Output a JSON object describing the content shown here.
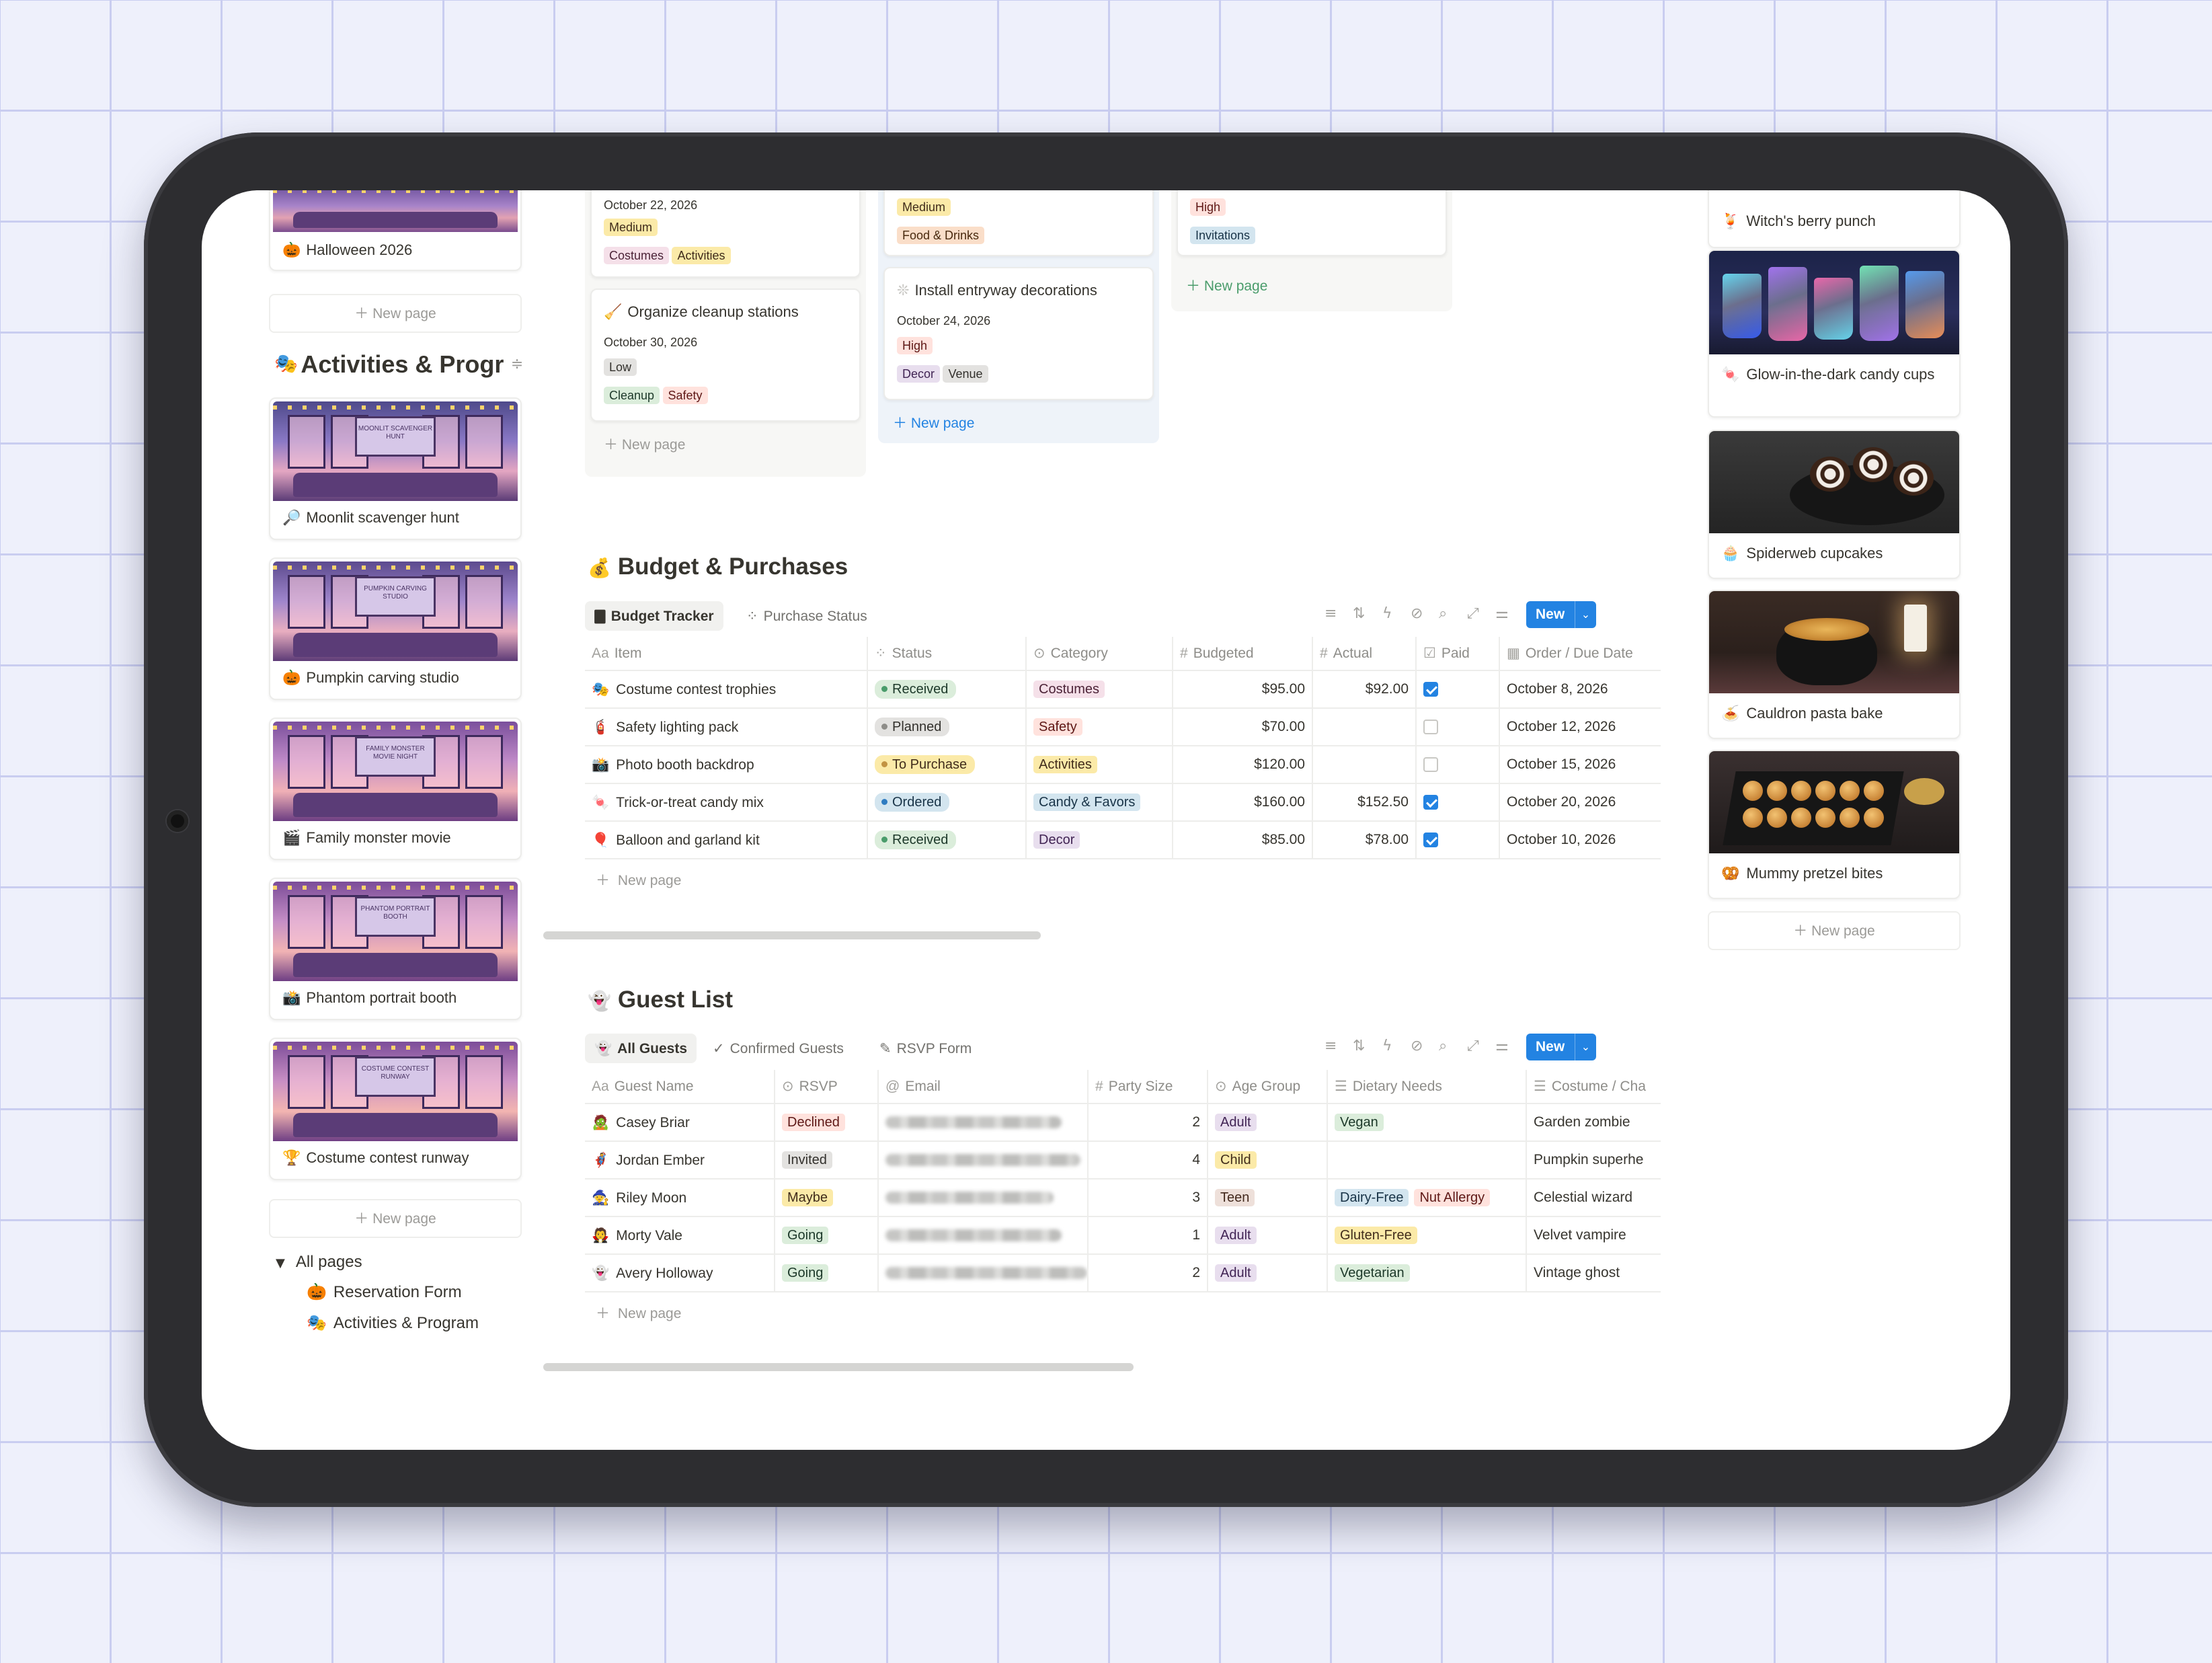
{
  "left_sidebar": {
    "halloween_card_label": "Halloween 2026",
    "new_page": "New page",
    "section_title": "Activities & Progr",
    "gallery": [
      {
        "label": "Moonlit scavenger hunt",
        "icon": "magnifier-icon",
        "sign": "MOONLIT SCAVENGER HUNT"
      },
      {
        "label": "Pumpkin carving studio",
        "icon": "pumpkin-icon",
        "sign": "PUMPKIN CARVING STUDIO"
      },
      {
        "label": "Family monster movie",
        "icon": "clapper-icon",
        "sign": "FAMILY MONSTER MOVIE NIGHT"
      },
      {
        "label": "Phantom portrait booth",
        "icon": "camera-icon",
        "sign": "PHANTOM PORTRAIT BOOTH"
      },
      {
        "label": "Costume contest runway",
        "icon": "trophy-icon",
        "sign": "COSTUME CONTEST RUNWAY"
      }
    ],
    "all_pages_label": "All pages",
    "tree_items": [
      "Reservation Form",
      "Activities & Program"
    ]
  },
  "board": {
    "col1": {
      "card_top": {
        "date": "October 22, 2026",
        "priority": "Medium",
        "tags": [
          "Costumes",
          "Activities"
        ]
      },
      "card2": {
        "title": "Organize cleanup stations",
        "date": "October 30, 2026",
        "priority": "Low",
        "tags": [
          "Cleanup",
          "Safety"
        ]
      },
      "new_page": "New page"
    },
    "col2": {
      "card_top": {
        "priority": "Medium",
        "tags": [
          "Food & Drinks"
        ]
      },
      "card2": {
        "title": "Install entryway decorations",
        "date": "October 24, 2026",
        "priority": "High",
        "tags": [
          "Decor",
          "Venue"
        ]
      },
      "new_page": "New page"
    },
    "col3": {
      "card_top": {
        "priority": "High",
        "tags": [
          "Invitations"
        ]
      },
      "new_page": "New page"
    }
  },
  "budget": {
    "title": "Budget & Purchases",
    "views": [
      "Budget Tracker",
      "Purchase Status"
    ],
    "new_label": "New",
    "columns": [
      "Item",
      "Status",
      "Category",
      "Budgeted",
      "Actual",
      "Paid",
      "Order / Due Date"
    ],
    "rows": [
      {
        "item": "Costume contest trophies",
        "status": "Received",
        "category": "Costumes",
        "budgeted": "$95.00",
        "actual": "$92.00",
        "paid": true,
        "date": "October 8, 2026"
      },
      {
        "item": "Safety lighting pack",
        "status": "Planned",
        "category": "Safety",
        "budgeted": "$70.00",
        "actual": "",
        "paid": false,
        "date": "October 12, 2026"
      },
      {
        "item": "Photo booth backdrop",
        "status": "To Purchase",
        "category": "Activities",
        "budgeted": "$120.00",
        "actual": "",
        "paid": false,
        "date": "October 15, 2026"
      },
      {
        "item": "Trick-or-treat candy mix",
        "status": "Ordered",
        "category": "Candy & Favors",
        "budgeted": "$160.00",
        "actual": "$152.50",
        "paid": true,
        "date": "October 20, 2026"
      },
      {
        "item": "Balloon and garland kit",
        "status": "Received",
        "category": "Decor",
        "budgeted": "$85.00",
        "actual": "$78.00",
        "paid": true,
        "date": "October 10, 2026"
      }
    ],
    "new_page": "New page"
  },
  "guests": {
    "title": "Guest List",
    "views": [
      "All Guests",
      "Confirmed Guests",
      "RSVP Form"
    ],
    "new_label": "New",
    "columns": [
      "Guest Name",
      "RSVP",
      "Email",
      "Party Size",
      "Age Group",
      "Dietary Needs",
      "Costume / Cha"
    ],
    "rows": [
      {
        "name": "Casey Briar",
        "rsvp": "Declined",
        "party": "2",
        "age": "Adult",
        "diet": [
          "Vegan"
        ],
        "costume": "Garden zombie"
      },
      {
        "name": "Jordan Ember",
        "rsvp": "Invited",
        "party": "4",
        "age": "Child",
        "diet": [],
        "costume": "Pumpkin superhe"
      },
      {
        "name": "Riley Moon",
        "rsvp": "Maybe",
        "party": "3",
        "age": "Teen",
        "diet": [
          "Dairy-Free",
          "Nut Allergy"
        ],
        "costume": "Celestial wizard"
      },
      {
        "name": "Morty Vale",
        "rsvp": "Going",
        "party": "1",
        "age": "Adult",
        "diet": [
          "Gluten-Free"
        ],
        "costume": "Velvet vampire"
      },
      {
        "name": "Avery Holloway",
        "rsvp": "Going",
        "party": "2",
        "age": "Adult",
        "diet": [
          "Vegetarian"
        ],
        "costume": "Vintage ghost"
      }
    ],
    "new_page": "New page"
  },
  "right_gallery": {
    "items": [
      {
        "label": "Witch's berry punch",
        "icon": "drink-icon"
      },
      {
        "label": "Glow-in-the-dark candy cups",
        "icon": "candy-icon"
      },
      {
        "label": "Spiderweb cupcakes",
        "icon": "cupcake-icon"
      },
      {
        "label": "Cauldron pasta bake",
        "icon": "pasta-icon"
      },
      {
        "label": "Mummy pretzel bites",
        "icon": "pretzel-icon"
      }
    ],
    "new_page": "New page"
  }
}
